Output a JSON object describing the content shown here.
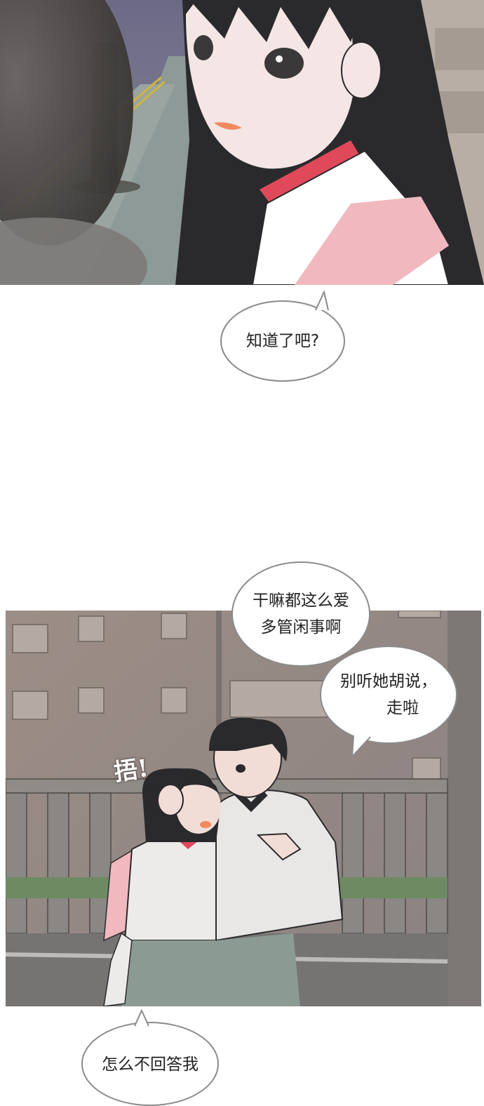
{
  "panels": [
    {
      "name": "girl-closeup-panel"
    },
    {
      "name": "couple-walking-panel"
    }
  ],
  "dialogue": {
    "bubble_1": "知道了吧?",
    "bubble_2_line_1": "干嘛都这么爱",
    "bubble_2_line_2": "多管闲事啊",
    "bubble_3_line_1": "别听她胡说，",
    "bubble_3_line_2": "走啦",
    "bubble_4": "怎么不回答我"
  },
  "sound_effect": "捂!",
  "colors": {
    "background": "#ffffff",
    "bubble_border": "#8a8a8a",
    "collar_red": "#e0495a",
    "backpack_pink": "#f1b9bf"
  }
}
